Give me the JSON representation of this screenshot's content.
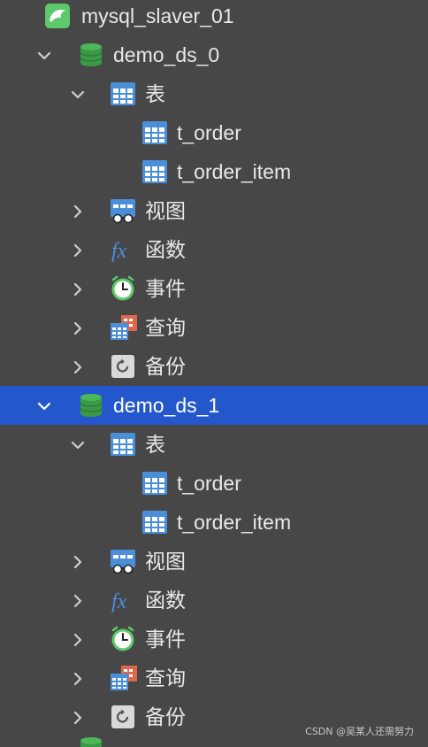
{
  "tree": {
    "connection": {
      "label": "mysql_slaver_01",
      "icon": "dolphin-icon",
      "color": "#5cc96a"
    },
    "databases": [
      {
        "label": "demo_ds_0",
        "icon": "database-icon",
        "tables_group": {
          "label": "表",
          "icon": "table-icon"
        },
        "tables": [
          {
            "label": "t_order",
            "icon": "table-icon"
          },
          {
            "label": "t_order_item",
            "icon": "table-icon"
          }
        ],
        "groups": [
          {
            "label": "视图",
            "icon": "view-icon"
          },
          {
            "label": "函数",
            "icon": "function-icon"
          },
          {
            "label": "事件",
            "icon": "clock-icon"
          },
          {
            "label": "查询",
            "icon": "query-icon"
          },
          {
            "label": "备份",
            "icon": "backup-icon"
          }
        ]
      },
      {
        "label": "demo_ds_1",
        "icon": "database-icon",
        "selected": true,
        "tables_group": {
          "label": "表",
          "icon": "table-icon"
        },
        "tables": [
          {
            "label": "t_order",
            "icon": "table-icon"
          },
          {
            "label": "t_order_item",
            "icon": "table-icon"
          }
        ],
        "groups": [
          {
            "label": "视图",
            "icon": "view-icon"
          },
          {
            "label": "函数",
            "icon": "function-icon"
          },
          {
            "label": "事件",
            "icon": "clock-icon"
          },
          {
            "label": "查询",
            "icon": "query-icon"
          },
          {
            "label": "备份",
            "icon": "backup-icon"
          }
        ]
      }
    ]
  },
  "colors": {
    "background": "#474747",
    "selection": "#2457cc",
    "database_green": "#3fa34d",
    "table_blue": "#4a8fd8"
  },
  "watermark": "CSDN @吴某人还需努力"
}
